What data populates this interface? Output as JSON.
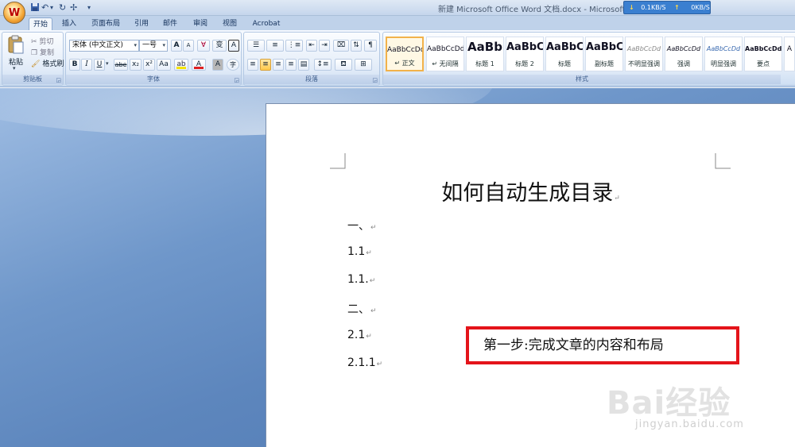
{
  "window": {
    "title": "新建 Microsoft Office Word 文档.docx - Microsoft Wo",
    "office_button": "W"
  },
  "quick_access": {
    "more": "▾"
  },
  "net_monitor": {
    "down": "0.1KB/S",
    "up": "0KB/S"
  },
  "tabs": [
    {
      "label": "开始",
      "active": true
    },
    {
      "label": "插入"
    },
    {
      "label": "页面布局"
    },
    {
      "label": "引用"
    },
    {
      "label": "邮件"
    },
    {
      "label": "审阅"
    },
    {
      "label": "视图"
    },
    {
      "label": "Acrobat"
    }
  ],
  "clipboard": {
    "group_label": "剪贴板",
    "paste": "粘贴",
    "cut": "剪切",
    "copy": "复制",
    "format_painter": "格式刷"
  },
  "font": {
    "group_label": "字体",
    "font_name": "宋体 (中文正文)",
    "font_size": "一号",
    "bold": "B",
    "italic": "I",
    "underline": "U",
    "strike": "abe",
    "subscript": "x₂",
    "superscript": "x²",
    "change_case": "Aa",
    "grow": "A",
    "shrink": "A",
    "clear_format": "ꓯ",
    "phonetic": "变",
    "char_border": "A",
    "font_color": "A",
    "char_shading": "A",
    "enclose": "字"
  },
  "paragraph": {
    "group_label": "段落"
  },
  "styles": {
    "group_label": "样式",
    "items": [
      {
        "sample": "AaBbCcDd",
        "name": "↵ 正文",
        "selected": true
      },
      {
        "sample": "AaBbCcDd",
        "name": "↵ 无间隔"
      },
      {
        "sample": "AaBb",
        "name": "标题 1"
      },
      {
        "sample": "AaBbC",
        "name": "标题 2"
      },
      {
        "sample": "AaBbC",
        "name": "标题"
      },
      {
        "sample": "AaBbC",
        "name": "副标题"
      },
      {
        "sample": "AaBbCcDd",
        "name": "不明显强调"
      },
      {
        "sample": "AaBbCcDd",
        "name": "强调"
      },
      {
        "sample": "AaBbCcDd",
        "name": "明显强调"
      },
      {
        "sample": "AaBbCcDd",
        "name": "要点"
      },
      {
        "sample": "A",
        "name": ""
      }
    ]
  },
  "document": {
    "title": "如何自动生成目录",
    "paragraph_mark": "↵",
    "lines": [
      "一、",
      "1.1",
      "1.1.",
      "二、",
      "2.1",
      "2.1.1"
    ],
    "callout": "第一步:完成文章的内容和布局"
  },
  "watermark": {
    "main": "Bai经验",
    "sub": "jingyan.baidu.com"
  },
  "colors": {
    "callout_border": "#e4141a",
    "font_color_bar": "#e02020",
    "highlight_bar": "#f5e400"
  }
}
